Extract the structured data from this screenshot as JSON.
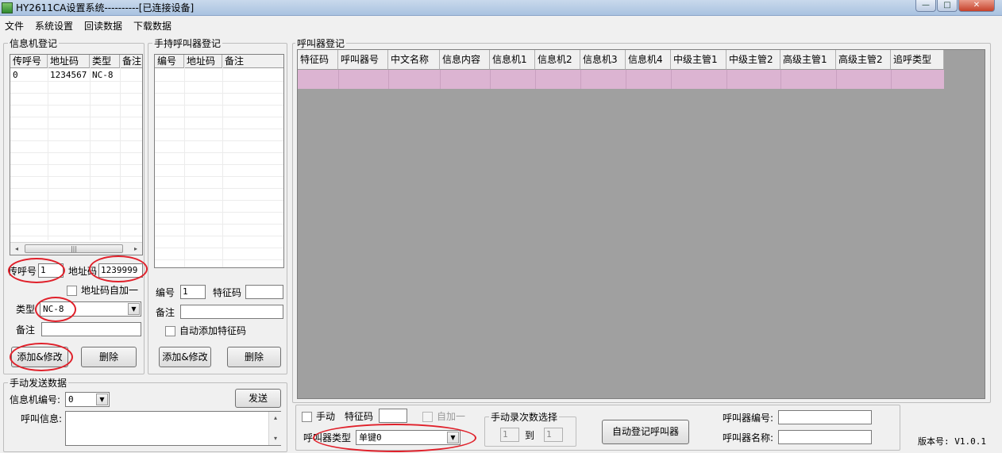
{
  "window": {
    "title": "HY2611CA设置系统----------[已连接设备]",
    "minimize": "—",
    "maximize": "□",
    "close": "✕"
  },
  "menu": [
    "文件",
    "系统设置",
    "回读数据",
    "下载数据"
  ],
  "info_machine": {
    "legend": "信息机登记",
    "columns": [
      "传呼号",
      "地址码",
      "类型",
      "备注"
    ],
    "rows": [
      {
        "call": "0",
        "addr": "1234567",
        "type": "NC-8",
        "note": ""
      }
    ],
    "call_label": "传呼号",
    "call_value": "1",
    "addr_label": "地址码",
    "addr_value": "1239999",
    "auto_inc_label": "地址码自加一",
    "type_label": "类型",
    "type_value": "NC-8",
    "note_label": "备注",
    "note_value": "",
    "add_button": "添加&修改",
    "delete_button": "删除",
    "scroll_thumb": "|||"
  },
  "handheld": {
    "legend": "手持呼叫器登记",
    "columns": [
      "编号",
      "地址码",
      "备注"
    ],
    "number_label": "编号",
    "number_value": "1",
    "feature_label": "特征码",
    "feature_value": "",
    "note_label": "备注",
    "note_value": "",
    "auto_feature_label": "自动添加特征码",
    "add_button": "添加&修改",
    "delete_button": "删除"
  },
  "manual_send": {
    "legend": "手动发送数据",
    "machine_no_label": "信息机编号:",
    "machine_no_value": "0",
    "send_button": "发送",
    "call_info_label": "呼叫信息:",
    "call_info_value": ""
  },
  "caller_reg": {
    "legend": "呼叫器登记",
    "columns": [
      "特征码",
      "呼叫器号",
      "中文名称",
      "信息内容",
      "信息机1",
      "信息机2",
      "信息机3",
      "信息机4",
      "中级主管1",
      "中级主管2",
      "高级主管1",
      "高级主管2",
      "追呼类型"
    ]
  },
  "bottom": {
    "manual_label": "手动",
    "feature_label": "特征码",
    "feature_value": "",
    "auto_inc_label": "自加一",
    "caller_type_label": "呼叫器类型",
    "caller_type_value": "单键0",
    "record_legend": "手动录次数选择",
    "from_value": "1",
    "to_label": "到",
    "to_value": "1",
    "auto_register_button": "自动登记呼叫器",
    "caller_no_label": "呼叫器编号:",
    "caller_no_value": "",
    "caller_name_label": "呼叫器名称:",
    "caller_name_value": "",
    "version": "版本号: V1.0.1"
  },
  "colors": {
    "grid_bg": "#a0a0a0",
    "selected_row": "#dcb4d2",
    "annotation_red": "#e0202a"
  },
  "icons": {
    "dropdown": "▼",
    "scroll_left": "◂",
    "scroll_right": "▸",
    "scroll_up": "▴",
    "scroll_down": "▾"
  }
}
